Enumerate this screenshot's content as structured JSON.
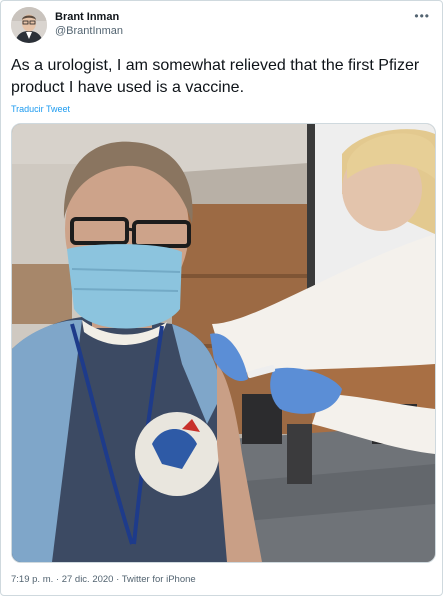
{
  "author": {
    "display_name": "Brant Inman",
    "handle": "@BrantInman"
  },
  "tweet": {
    "text": "As a urologist, I am somewhat relieved that the first Pfizer product I have used is a vaccine.",
    "translate_label": "Traducir Tweet"
  },
  "footer": {
    "time": "7:19 p. m.",
    "separator": " · ",
    "date": "27 dic. 2020",
    "source": "Twitter for iPhone"
  },
  "icons": {
    "more": "more-horizontal-icon"
  },
  "colors": {
    "link": "#1d9bf0",
    "secondary_text": "#536471"
  }
}
